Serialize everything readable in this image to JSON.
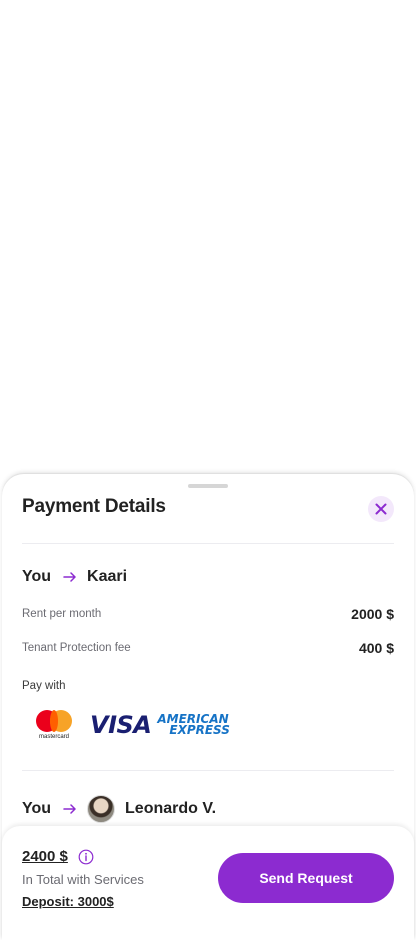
{
  "sheet": {
    "title": "Payment Details",
    "icons": {
      "close": "close-icon",
      "arrow": "arrow-right-icon",
      "info": "info-icon"
    },
    "accent_color": "#8c2bd0"
  },
  "transfers": [
    {
      "from": "You",
      "to": "Kaari",
      "items": [
        {
          "label": "Rent per month",
          "value": "2000 $"
        },
        {
          "label": "Tenant Protection fee",
          "value": "400 $"
        }
      ],
      "pay_with_label": "Pay with",
      "payment_methods": [
        "mastercard",
        "VISA",
        "AMERICAN",
        "EXPRESS"
      ]
    },
    {
      "from": "You",
      "to": "Leonardo V."
    }
  ],
  "footer": {
    "total": "2400 $",
    "caption": "In Total with Services",
    "deposit": "Deposit: 3000$",
    "button_label": "Send Request"
  }
}
